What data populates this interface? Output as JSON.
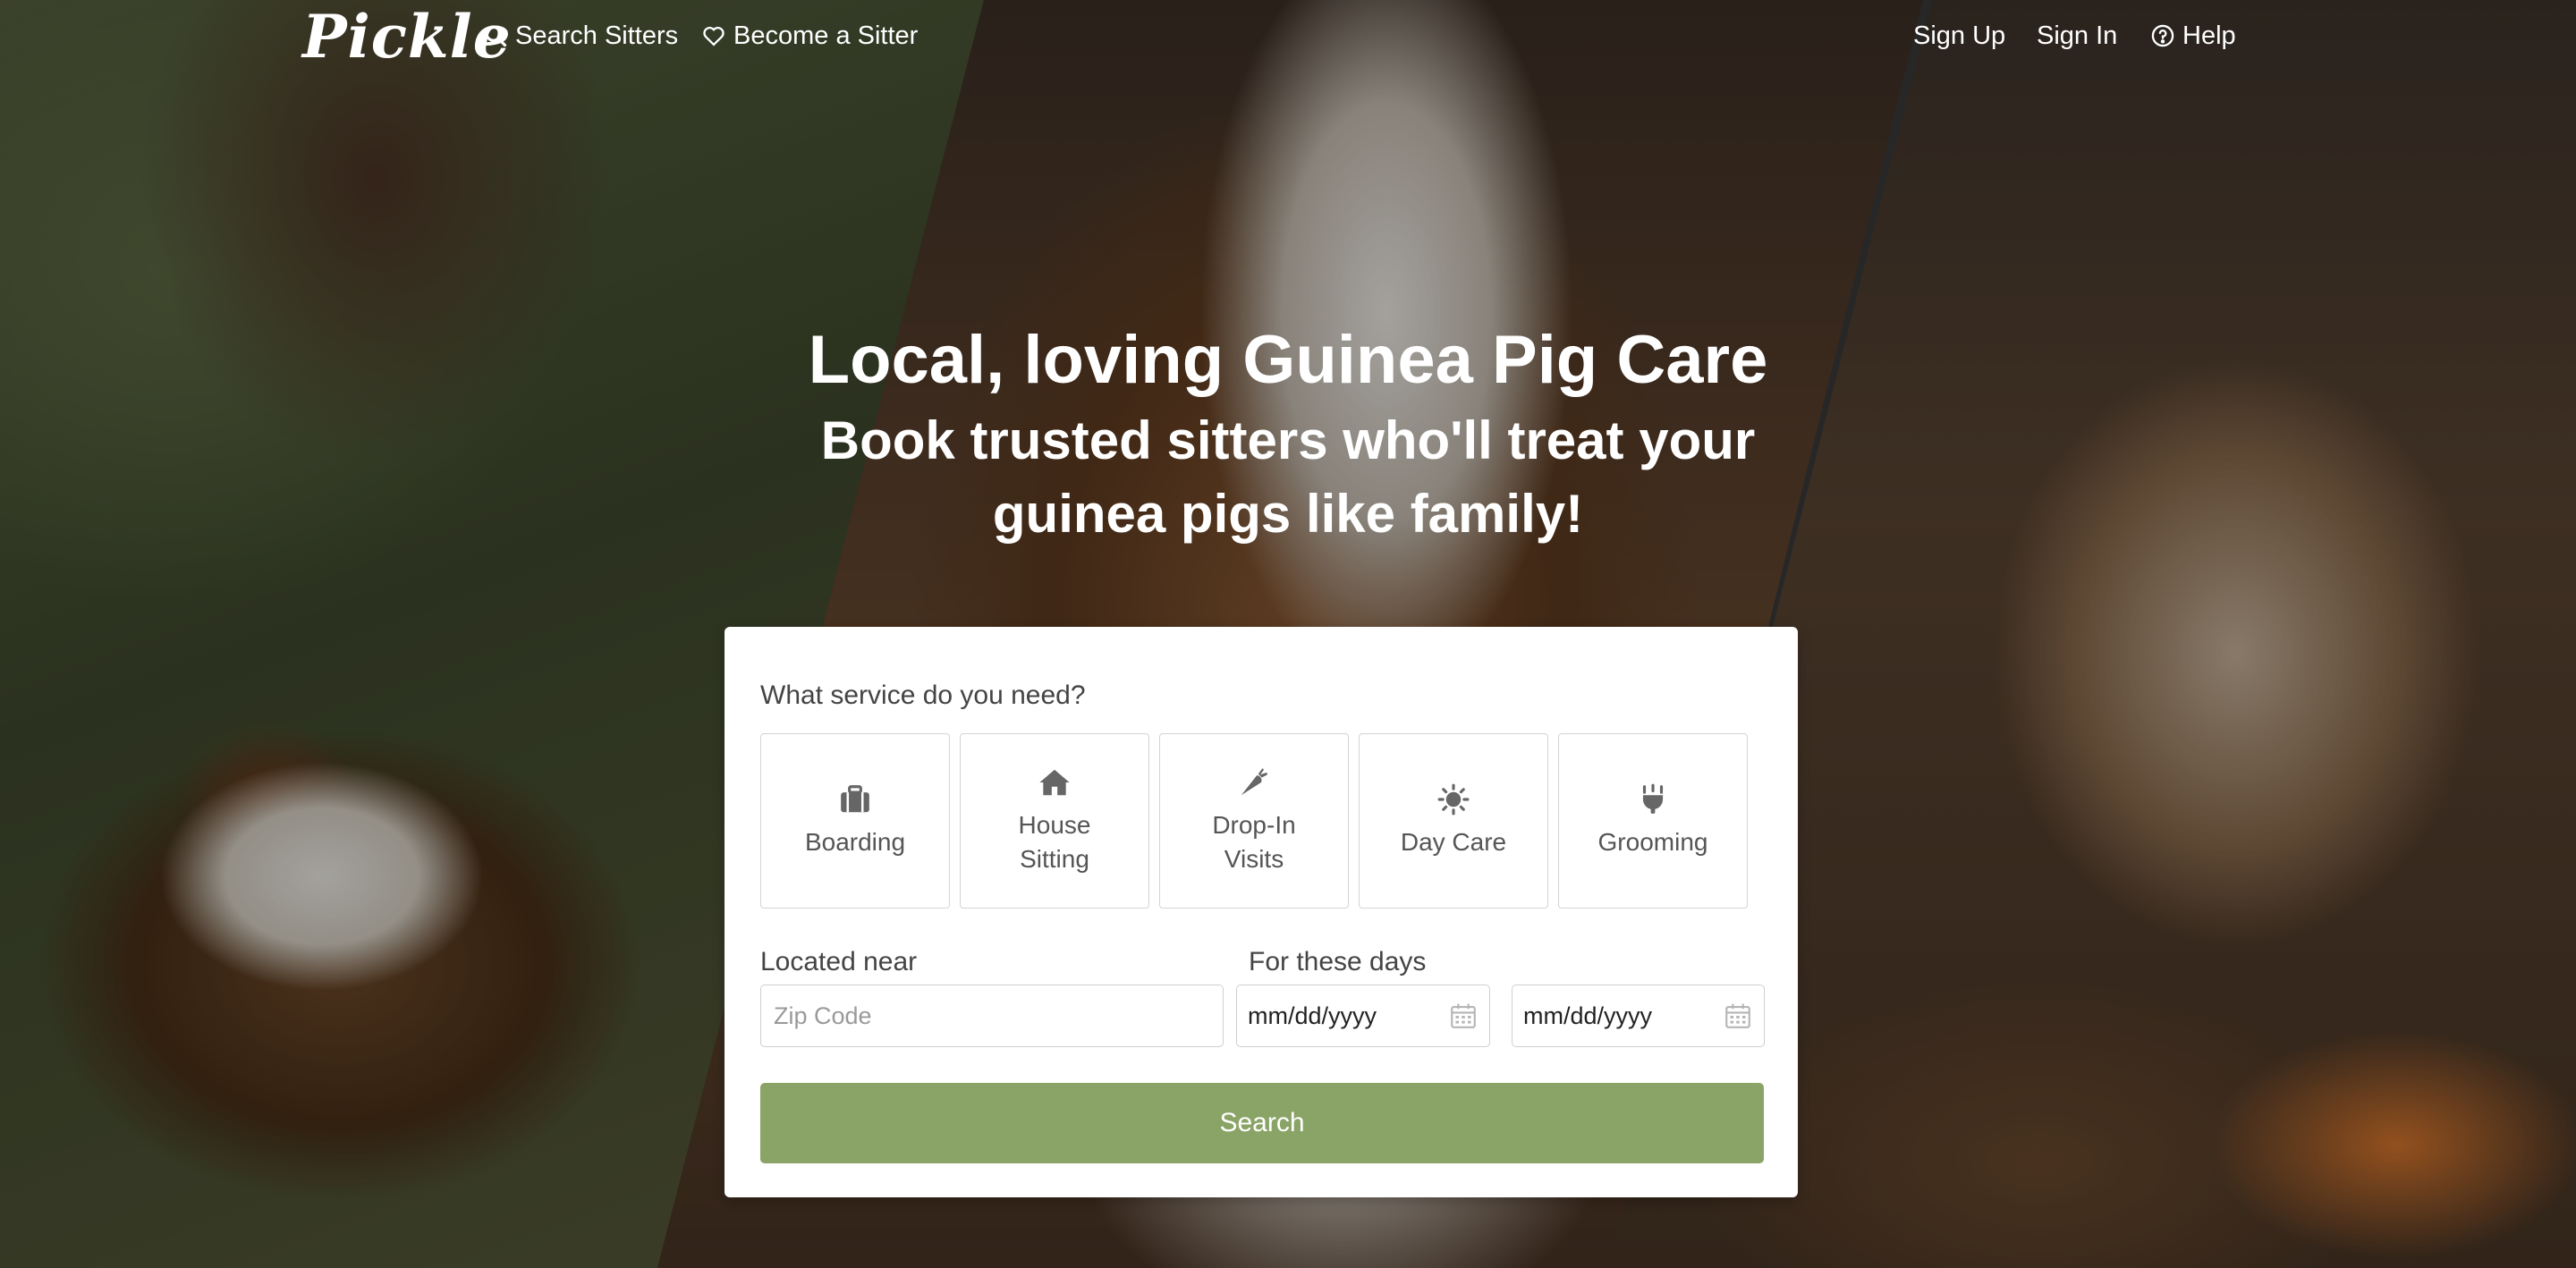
{
  "brand": {
    "logo_text": "Pickle"
  },
  "nav": {
    "search_sitters": "Search Sitters",
    "become_sitter": "Become a Sitter",
    "sign_up": "Sign Up",
    "sign_in": "Sign In",
    "help": "Help"
  },
  "hero": {
    "title": "Local, loving Guinea Pig Care",
    "subtitle": "Book trusted sitters who'll treat your guinea pigs like family!"
  },
  "search_form": {
    "service_question": "What service do you need?",
    "services": [
      {
        "label": "Boarding",
        "icon": "suitcase-icon"
      },
      {
        "label": "House\nSitting",
        "icon": "house-icon"
      },
      {
        "label": "Drop-In\nVisits",
        "icon": "carrot-icon"
      },
      {
        "label": "Day Care",
        "icon": "sun-icon"
      },
      {
        "label": "Grooming",
        "icon": "grooming-icon"
      }
    ],
    "location_label": "Located near",
    "zip_placeholder": "Zip Code",
    "days_label": "For these days",
    "start_date": "mm/dd/yyyy",
    "end_date": "mm/dd/yyyy",
    "search_button": "Search"
  },
  "colors": {
    "accent": "#8aa366",
    "card_bg": "#ffffff",
    "text": "#444444"
  }
}
